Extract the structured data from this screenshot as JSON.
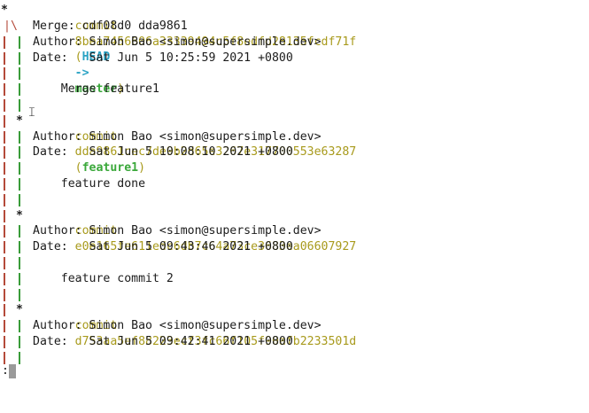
{
  "terminal": {
    "commits": [
      {
        "hash": "8bea7456606a33339494c5f8edfd28135fcdf71f",
        "refs": {
          "head": "HEAD",
          "arrow": "->",
          "branch": "master"
        },
        "merge": "Merge: cdf08d0 dda9861",
        "author": "Author: Simon Bao <simon@supersimple.dev>",
        "date": "Date:   Sat Jun 5 10:25:59 2021 +0800",
        "message": "    Merge feature1"
      },
      {
        "hash": "dda9861cec7de9b2d65e3267e317700553e63287",
        "refs": {
          "branch": "feature1"
        },
        "author": "Author: Simon Bao <simon@supersimple.dev>",
        "date": "Date:   Sat Jun 5 10:08:10 2021 +0800",
        "message": "    feature done"
      },
      {
        "hash": "e0e165fe611edc6db7c64a73ce3683ea06607927",
        "author": "Author: Simon Bao <simon@supersimple.dev>",
        "date": "Date:   Sat Jun 5 09:43:46 2021 +0800",
        "message": "    feature commit 2"
      },
      {
        "hash": "d753aa5ef88223ecf3fc66f105f90afb2233501d",
        "author": "Author: Simon Bao <simon@supersimple.dev>",
        "date": "Date:   Sat Jun 5 09:42:41 2021 +0800"
      }
    ],
    "commit_word": "commit",
    "pager_prompt": ":",
    "colors": {
      "commit": "#a89a1c",
      "head": "#2aa3c4",
      "branch": "#3aa83a",
      "graph_red": "#b44a3a",
      "graph_green": "#3a9c3a"
    },
    "icons": [
      "text-cursor-icon",
      "block-cursor-icon"
    ]
  }
}
